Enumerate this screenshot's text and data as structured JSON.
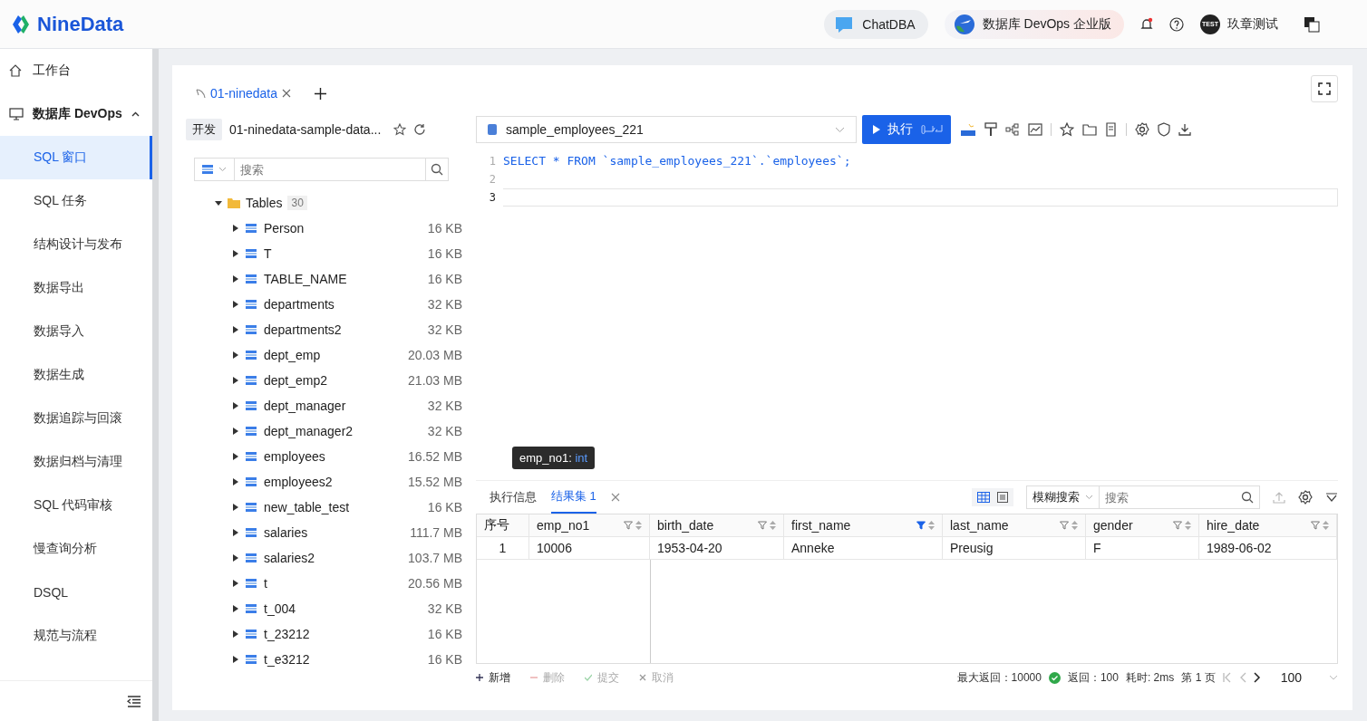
{
  "header": {
    "logo": "NineData",
    "chatdba": "ChatDBA",
    "edition": "数据库 DevOps 企业版",
    "user_badge": "TEST",
    "user": "玖章测试"
  },
  "sidebar": {
    "items": [
      {
        "kind": "top",
        "label": "工作台",
        "selected": false
      },
      {
        "kind": "group",
        "label": "数据库 DevOps",
        "expanded": true,
        "children": [
          {
            "label": "SQL 窗口",
            "selected": true
          },
          {
            "label": "SQL 任务",
            "selected": false
          },
          {
            "label": "结构设计与发布",
            "selected": false
          },
          {
            "label": "数据导出",
            "selected": false
          },
          {
            "label": "数据导入",
            "selected": false
          },
          {
            "label": "数据生成",
            "selected": false
          },
          {
            "label": "数据追踪与回滚",
            "selected": false
          },
          {
            "label": "数据归档与清理",
            "selected": false
          },
          {
            "label": "SQL 代码审核",
            "selected": false
          },
          {
            "label": "慢查询分析",
            "selected": false
          },
          {
            "label": "DSQL",
            "selected": false
          },
          {
            "label": "规范与流程",
            "selected": false
          }
        ]
      }
    ]
  },
  "tabs": [
    {
      "label": "01-ninedata",
      "selected": true
    }
  ],
  "connection": {
    "env": "开发",
    "name": "01-ninedata-sample-data..."
  },
  "tree_search": {
    "placeholder": "搜索"
  },
  "tree": {
    "label": "Tables",
    "count": "30",
    "expanded": true,
    "children": [
      {
        "name": "Person",
        "size": "16 KB"
      },
      {
        "name": "T",
        "size": "16 KB"
      },
      {
        "name": "TABLE_NAME",
        "size": "16 KB"
      },
      {
        "name": "departments",
        "size": "32 KB"
      },
      {
        "name": "departments2",
        "size": "32 KB"
      },
      {
        "name": "dept_emp",
        "size": "20.03 MB"
      },
      {
        "name": "dept_emp2",
        "size": "21.03 MB"
      },
      {
        "name": "dept_manager",
        "size": "32 KB"
      },
      {
        "name": "dept_manager2",
        "size": "32 KB"
      },
      {
        "name": "employees",
        "size": "16.52 MB"
      },
      {
        "name": "employees2",
        "size": "15.52 MB"
      },
      {
        "name": "new_table_test",
        "size": "16 KB"
      },
      {
        "name": "salaries",
        "size": "111.7 MB"
      },
      {
        "name": "salaries2",
        "size": "103.7 MB"
      },
      {
        "name": "t",
        "size": "20.56 MB"
      },
      {
        "name": "t_004",
        "size": "32 KB"
      },
      {
        "name": "t_23212",
        "size": "16 KB"
      },
      {
        "name": "t_e3212",
        "size": "16 KB"
      }
    ]
  },
  "database_select": "sample_employees_221",
  "run_button": "执行",
  "editor": {
    "lines": [
      {
        "number": "1",
        "code": "SELECT * FROM `sample_employees_221`.`employees`;",
        "current": false
      },
      {
        "number": "2",
        "current": false
      },
      {
        "number": "3",
        "current": true
      }
    ]
  },
  "result_tabs": [
    {
      "label": "执行信息",
      "selected": false
    },
    {
      "label": "结果集 1",
      "selected": true
    }
  ],
  "tooltip": {
    "name": "emp_no1:",
    "type": "int"
  },
  "result_search": {
    "mode": "模糊搜索",
    "placeholder": "搜索"
  },
  "table": {
    "columns": [
      {
        "label": "序号",
        "kind": "index"
      },
      {
        "label": "emp_no1",
        "kind": "field",
        "filtered": false
      },
      {
        "label": "birth_date",
        "kind": "field",
        "filtered": false
      },
      {
        "label": "first_name",
        "kind": "field",
        "filtered": true
      },
      {
        "label": "last_name",
        "kind": "field",
        "filtered": false
      },
      {
        "label": "gender",
        "kind": "field",
        "filtered": false
      },
      {
        "label": "hire_date",
        "kind": "field",
        "filtered": false
      }
    ],
    "rows": [
      [
        "1",
        "10006",
        "1953-04-20",
        "Anneke",
        "Preusig",
        "F",
        "1989-06-02"
      ]
    ]
  },
  "footer": {
    "actions": [
      {
        "kind": "add",
        "label": "新增",
        "disabled": false
      },
      {
        "kind": "delete",
        "label": "删除",
        "disabled": true
      },
      {
        "kind": "submit",
        "label": "提交",
        "disabled": true
      },
      {
        "kind": "cancel",
        "label": "取消",
        "disabled": true
      }
    ],
    "max_return": "最大返回：10000",
    "returned": "返回：100",
    "elapsed": "耗时: 2ms",
    "page": "第 1 页",
    "page_size": "100"
  }
}
